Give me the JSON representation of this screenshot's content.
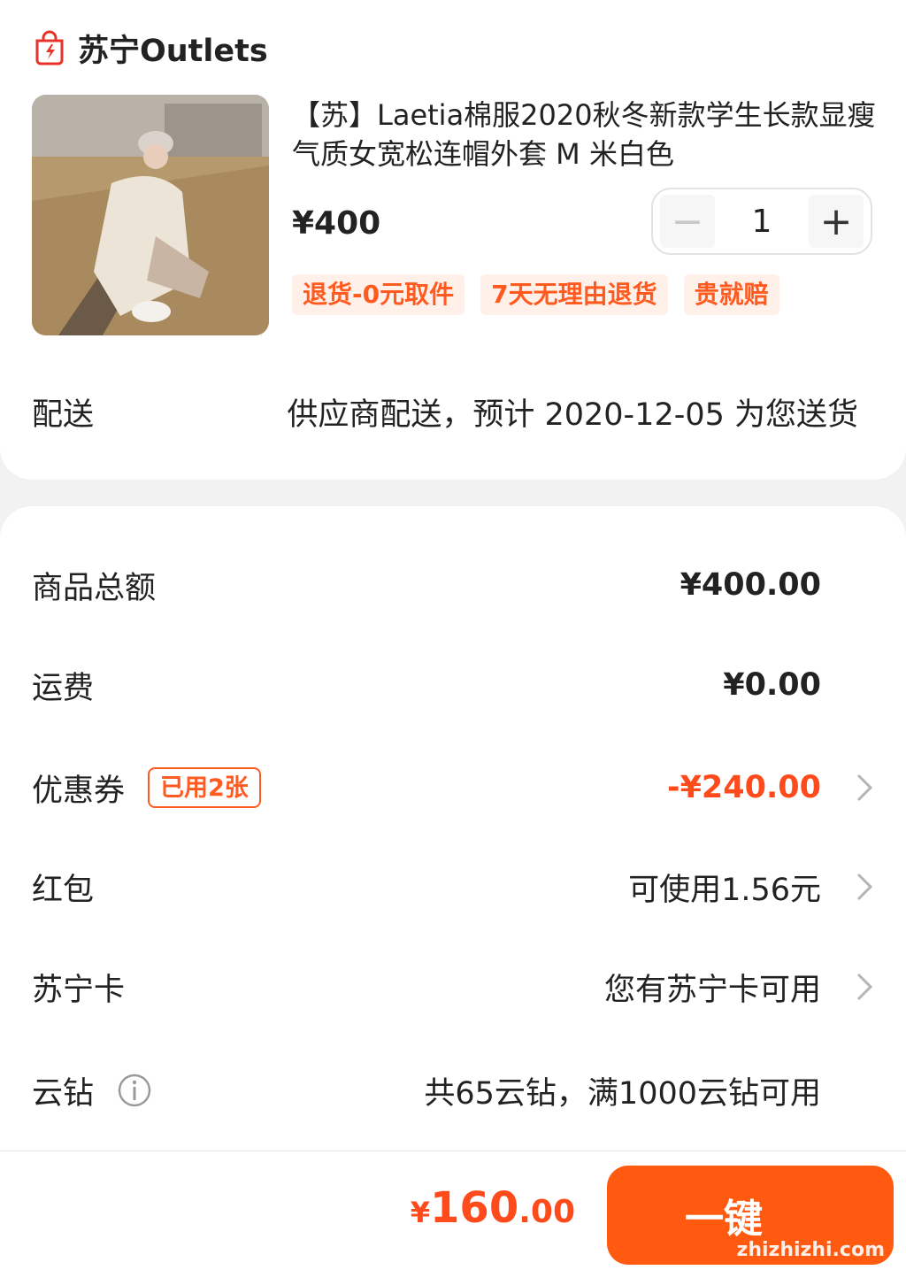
{
  "store": {
    "name": "苏宁Outlets"
  },
  "product": {
    "title": "【苏】Laetia棉服2020秋冬新款学生长款显瘦气质女宽松连帽外套 M 米白色",
    "price": "¥400",
    "quantity": "1",
    "minus": "−",
    "plus": "+",
    "tags": [
      "退货-0元取件",
      "7天无理由退货",
      "贵就赔"
    ]
  },
  "shipping": {
    "label": "配送",
    "value": "供应商配送，预计 2020-12-05 为您送货"
  },
  "summary": {
    "goods_total": {
      "label": "商品总额",
      "value": "¥400.00"
    },
    "freight": {
      "label": "运费",
      "value": "¥0.00"
    },
    "coupon": {
      "label": "优惠券",
      "badge": "已用2张",
      "value": "-¥240.00"
    },
    "red_packet": {
      "label": "红包",
      "value": "可使用1.56元"
    },
    "suning_card": {
      "label": "苏宁卡",
      "value": "您有苏宁卡可用"
    },
    "cloud_diamond": {
      "label": "云钻",
      "value": "共65云钻，满1000云钻可用"
    }
  },
  "footer": {
    "total_symbol": "¥",
    "total_int": "160",
    "total_dec": ".00",
    "buy_label": "一键",
    "watermark": "zhizhizhi.com"
  },
  "colors": {
    "accent": "#ff5a0f",
    "price_red": "#ff4b1c",
    "tag_bg": "#fff1ea"
  }
}
